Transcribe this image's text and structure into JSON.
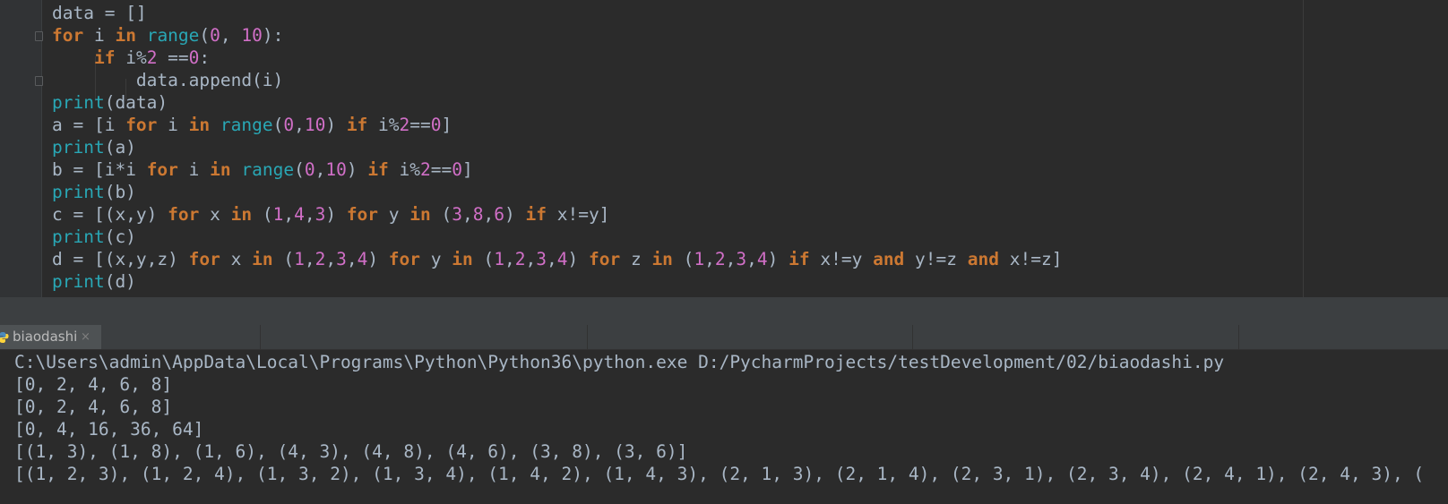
{
  "editor": {
    "lines": [
      [
        {
          "t": "data",
          "c": "var"
        },
        {
          "t": " = []",
          "c": "op"
        }
      ],
      [
        {
          "t": "for",
          "c": "kw"
        },
        {
          "t": " i ",
          "c": "var"
        },
        {
          "t": "in",
          "c": "kw"
        },
        {
          "t": " ",
          "c": "op"
        },
        {
          "t": "range",
          "c": "bi"
        },
        {
          "t": "(",
          "c": "op"
        },
        {
          "t": "0",
          "c": "num"
        },
        {
          "t": ", ",
          "c": "op"
        },
        {
          "t": "10",
          "c": "num"
        },
        {
          "t": "):",
          "c": "op"
        }
      ],
      [
        {
          "t": "    ",
          "c": "op"
        },
        {
          "t": "if",
          "c": "kw"
        },
        {
          "t": " i",
          "c": "var"
        },
        {
          "t": "%",
          "c": "op"
        },
        {
          "t": "2",
          "c": "num"
        },
        {
          "t": " ==",
          "c": "op"
        },
        {
          "t": "0",
          "c": "num"
        },
        {
          "t": ":",
          "c": "op"
        }
      ],
      [
        {
          "t": "        data.append(i)",
          "c": "var"
        }
      ],
      [
        {
          "t": "print",
          "c": "bi"
        },
        {
          "t": "(data)",
          "c": "op"
        }
      ],
      [
        {
          "t": "a = [i ",
          "c": "var"
        },
        {
          "t": "for",
          "c": "kw"
        },
        {
          "t": " i ",
          "c": "var"
        },
        {
          "t": "in",
          "c": "kw"
        },
        {
          "t": " ",
          "c": "op"
        },
        {
          "t": "range",
          "c": "bi"
        },
        {
          "t": "(",
          "c": "op"
        },
        {
          "t": "0",
          "c": "num"
        },
        {
          "t": ",",
          "c": "op"
        },
        {
          "t": "10",
          "c": "num"
        },
        {
          "t": ") ",
          "c": "op"
        },
        {
          "t": "if",
          "c": "kw"
        },
        {
          "t": " i",
          "c": "var"
        },
        {
          "t": "%",
          "c": "op"
        },
        {
          "t": "2",
          "c": "num"
        },
        {
          "t": "==",
          "c": "op"
        },
        {
          "t": "0",
          "c": "num"
        },
        {
          "t": "]",
          "c": "op"
        }
      ],
      [
        {
          "t": "print",
          "c": "bi"
        },
        {
          "t": "(a)",
          "c": "op"
        }
      ],
      [
        {
          "t": "b = [i",
          "c": "var"
        },
        {
          "t": "*",
          "c": "op"
        },
        {
          "t": "i ",
          "c": "var"
        },
        {
          "t": "for",
          "c": "kw"
        },
        {
          "t": " i ",
          "c": "var"
        },
        {
          "t": "in",
          "c": "kw"
        },
        {
          "t": " ",
          "c": "op"
        },
        {
          "t": "range",
          "c": "bi"
        },
        {
          "t": "(",
          "c": "op"
        },
        {
          "t": "0",
          "c": "num"
        },
        {
          "t": ",",
          "c": "op"
        },
        {
          "t": "10",
          "c": "num"
        },
        {
          "t": ") ",
          "c": "op"
        },
        {
          "t": "if",
          "c": "kw"
        },
        {
          "t": " i",
          "c": "var"
        },
        {
          "t": "%",
          "c": "op"
        },
        {
          "t": "2",
          "c": "num"
        },
        {
          "t": "==",
          "c": "op"
        },
        {
          "t": "0",
          "c": "num"
        },
        {
          "t": "]",
          "c": "op"
        }
      ],
      [
        {
          "t": "print",
          "c": "bi"
        },
        {
          "t": "(b)",
          "c": "op"
        }
      ],
      [
        {
          "t": "c = [(x,y) ",
          "c": "var"
        },
        {
          "t": "for",
          "c": "kw"
        },
        {
          "t": " x ",
          "c": "var"
        },
        {
          "t": "in",
          "c": "kw"
        },
        {
          "t": " (",
          "c": "op"
        },
        {
          "t": "1",
          "c": "num"
        },
        {
          "t": ",",
          "c": "op"
        },
        {
          "t": "4",
          "c": "num"
        },
        {
          "t": ",",
          "c": "op"
        },
        {
          "t": "3",
          "c": "num"
        },
        {
          "t": ") ",
          "c": "op"
        },
        {
          "t": "for",
          "c": "kw"
        },
        {
          "t": " y ",
          "c": "var"
        },
        {
          "t": "in",
          "c": "kw"
        },
        {
          "t": " (",
          "c": "op"
        },
        {
          "t": "3",
          "c": "num"
        },
        {
          "t": ",",
          "c": "op"
        },
        {
          "t": "8",
          "c": "num"
        },
        {
          "t": ",",
          "c": "op"
        },
        {
          "t": "6",
          "c": "num"
        },
        {
          "t": ") ",
          "c": "op"
        },
        {
          "t": "if",
          "c": "kw"
        },
        {
          "t": " x",
          "c": "var"
        },
        {
          "t": "!=",
          "c": "op"
        },
        {
          "t": "y]",
          "c": "var"
        }
      ],
      [
        {
          "t": "print",
          "c": "bi"
        },
        {
          "t": "(c)",
          "c": "op"
        }
      ],
      [
        {
          "t": "d = [(x,y,z) ",
          "c": "var"
        },
        {
          "t": "for",
          "c": "kw"
        },
        {
          "t": " x ",
          "c": "var"
        },
        {
          "t": "in",
          "c": "kw"
        },
        {
          "t": " (",
          "c": "op"
        },
        {
          "t": "1",
          "c": "num"
        },
        {
          "t": ",",
          "c": "op"
        },
        {
          "t": "2",
          "c": "num"
        },
        {
          "t": ",",
          "c": "op"
        },
        {
          "t": "3",
          "c": "num"
        },
        {
          "t": ",",
          "c": "op"
        },
        {
          "t": "4",
          "c": "num"
        },
        {
          "t": ") ",
          "c": "op"
        },
        {
          "t": "for",
          "c": "kw"
        },
        {
          "t": " y ",
          "c": "var"
        },
        {
          "t": "in",
          "c": "kw"
        },
        {
          "t": " (",
          "c": "op"
        },
        {
          "t": "1",
          "c": "num"
        },
        {
          "t": ",",
          "c": "op"
        },
        {
          "t": "2",
          "c": "num"
        },
        {
          "t": ",",
          "c": "op"
        },
        {
          "t": "3",
          "c": "num"
        },
        {
          "t": ",",
          "c": "op"
        },
        {
          "t": "4",
          "c": "num"
        },
        {
          "t": ") ",
          "c": "op"
        },
        {
          "t": "for",
          "c": "kw"
        },
        {
          "t": " z ",
          "c": "var"
        },
        {
          "t": "in",
          "c": "kw"
        },
        {
          "t": " (",
          "c": "op"
        },
        {
          "t": "1",
          "c": "num"
        },
        {
          "t": ",",
          "c": "op"
        },
        {
          "t": "2",
          "c": "num"
        },
        {
          "t": ",",
          "c": "op"
        },
        {
          "t": "3",
          "c": "num"
        },
        {
          "t": ",",
          "c": "op"
        },
        {
          "t": "4",
          "c": "num"
        },
        {
          "t": ") ",
          "c": "op"
        },
        {
          "t": "if",
          "c": "kw"
        },
        {
          "t": " x",
          "c": "var"
        },
        {
          "t": "!=",
          "c": "op"
        },
        {
          "t": "y ",
          "c": "var"
        },
        {
          "t": "and",
          "c": "kw"
        },
        {
          "t": " y",
          "c": "var"
        },
        {
          "t": "!=",
          "c": "op"
        },
        {
          "t": "z ",
          "c": "var"
        },
        {
          "t": "and",
          "c": "kw"
        },
        {
          "t": " x",
          "c": "var"
        },
        {
          "t": "!=",
          "c": "op"
        },
        {
          "t": "z]",
          "c": "var"
        }
      ],
      [
        {
          "t": "print",
          "c": "bi"
        },
        {
          "t": "(d)",
          "c": "op"
        }
      ]
    ]
  },
  "run_panel": {
    "tab_label": "biaodashi",
    "close_glyph": "×"
  },
  "console": {
    "command": "C:\\Users\\admin\\AppData\\Local\\Programs\\Python\\Python36\\python.exe D:/PycharmProjects/testDevelopment/02/biaodashi.py",
    "output": [
      "[0, 2, 4, 6, 8]",
      "[0, 2, 4, 6, 8]",
      "[0, 4, 16, 36, 64]",
      "[(1, 3), (1, 8), (1, 6), (4, 3), (4, 8), (4, 6), (3, 8), (3, 6)]",
      "[(1, 2, 3), (1, 2, 4), (1, 3, 2), (1, 3, 4), (1, 4, 2), (1, 4, 3), (2, 1, 3), (2, 1, 4), (2, 3, 1), (2, 3, 4), (2, 4, 1), (2, 4, 3), ("
    ]
  },
  "colors": {
    "keyword": "#cc7832",
    "builtin": "#29a7b5",
    "number": "#d16fc7",
    "text": "#a9b7c6",
    "editor_bg": "#2b2b2b",
    "panel_bg": "#3c3f41"
  }
}
